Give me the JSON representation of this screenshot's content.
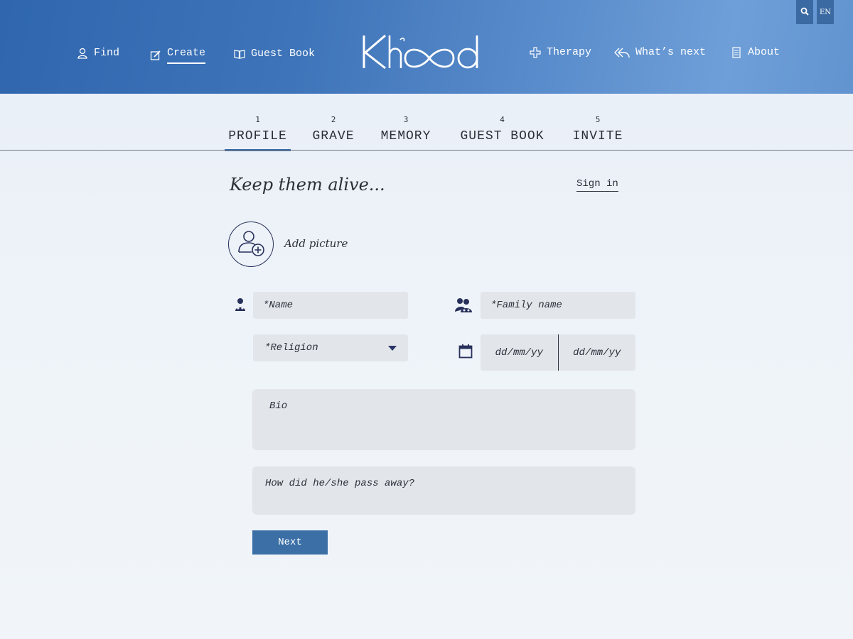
{
  "header": {
    "nav_left": [
      {
        "label": "Find",
        "icon": "user-icon"
      },
      {
        "label": "Create",
        "icon": "edit-icon"
      },
      {
        "label": "Guest Book",
        "icon": "book-icon"
      }
    ],
    "nav_right": [
      {
        "label": "Therapy",
        "icon": "plus-cross-icon"
      },
      {
        "label": "What’s next",
        "icon": "reply-all-icon"
      },
      {
        "label": "About",
        "icon": "document-icon"
      }
    ],
    "active_nav": "Create",
    "logo_text": "Khood",
    "language": "EN",
    "search_icon": "search-icon"
  },
  "steps": [
    {
      "num": "1",
      "name": "PROFILE",
      "active": true
    },
    {
      "num": "2",
      "name": "GRAVE"
    },
    {
      "num": "3",
      "name": "MEMORY"
    },
    {
      "num": "4",
      "name": "GUEST BOOK"
    },
    {
      "num": "5",
      "name": "INVITE"
    }
  ],
  "form": {
    "heading": "Keep them alive...",
    "sign_in": "Sign in",
    "add_picture": "Add picture",
    "name_placeholder": "*Name",
    "family_name_placeholder": "*Family name",
    "religion_placeholder": "*Religion",
    "date_from": "dd/mm/yy",
    "date_to": "dd/mm/yy",
    "bio_placeholder": "Bio",
    "pass_away_placeholder": "How did he/she pass away?",
    "next_label": "Next"
  },
  "colors": {
    "header_start": "#2f66ae",
    "header_end": "#6f9fd8",
    "accent": "#3b6fa6",
    "field_bg": "#e2e6ea",
    "icon_navy": "#27305a"
  }
}
